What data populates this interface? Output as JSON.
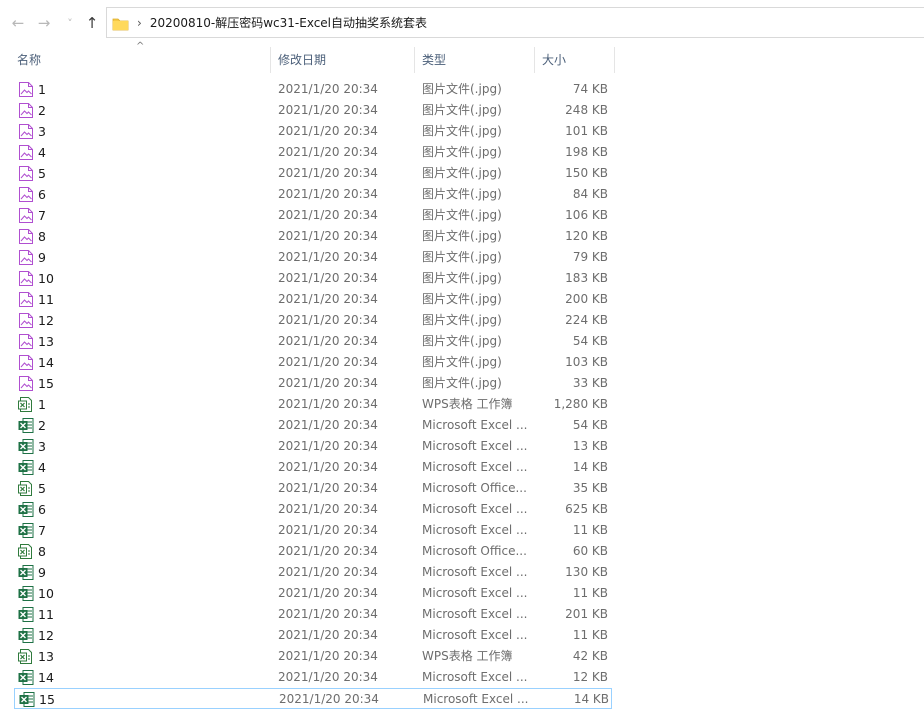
{
  "nav": {
    "back_glyph": "←",
    "forward_glyph": "→",
    "dropdown_glyph": "˅",
    "up_glyph": "↑",
    "separator": "›",
    "path": "20200810-解压密码wc31-Excel自动抽奖系统套表"
  },
  "sort_indicator": "^",
  "columns": {
    "name": "名称",
    "date": "修改日期",
    "type": "类型",
    "size": "大小"
  },
  "colors": {
    "image_icon": "#b04fd0",
    "excel_icon": "#1e7145",
    "wps_icon": "#2f7a3c",
    "header_text": "#4c607a",
    "selection_border": "#99d1ff"
  },
  "files": [
    {
      "name": "1",
      "date": "2021/1/20 20:34",
      "type": "图片文件(.jpg)",
      "size": "74 KB",
      "icon": "image-icon"
    },
    {
      "name": "2",
      "date": "2021/1/20 20:34",
      "type": "图片文件(.jpg)",
      "size": "248 KB",
      "icon": "image-icon"
    },
    {
      "name": "3",
      "date": "2021/1/20 20:34",
      "type": "图片文件(.jpg)",
      "size": "101 KB",
      "icon": "image-icon"
    },
    {
      "name": "4",
      "date": "2021/1/20 20:34",
      "type": "图片文件(.jpg)",
      "size": "198 KB",
      "icon": "image-icon"
    },
    {
      "name": "5",
      "date": "2021/1/20 20:34",
      "type": "图片文件(.jpg)",
      "size": "150 KB",
      "icon": "image-icon"
    },
    {
      "name": "6",
      "date": "2021/1/20 20:34",
      "type": "图片文件(.jpg)",
      "size": "84 KB",
      "icon": "image-icon"
    },
    {
      "name": "7",
      "date": "2021/1/20 20:34",
      "type": "图片文件(.jpg)",
      "size": "106 KB",
      "icon": "image-icon"
    },
    {
      "name": "8",
      "date": "2021/1/20 20:34",
      "type": "图片文件(.jpg)",
      "size": "120 KB",
      "icon": "image-icon"
    },
    {
      "name": "9",
      "date": "2021/1/20 20:34",
      "type": "图片文件(.jpg)",
      "size": "79 KB",
      "icon": "image-icon"
    },
    {
      "name": "10",
      "date": "2021/1/20 20:34",
      "type": "图片文件(.jpg)",
      "size": "183 KB",
      "icon": "image-icon"
    },
    {
      "name": "11",
      "date": "2021/1/20 20:34",
      "type": "图片文件(.jpg)",
      "size": "200 KB",
      "icon": "image-icon"
    },
    {
      "name": "12",
      "date": "2021/1/20 20:34",
      "type": "图片文件(.jpg)",
      "size": "224 KB",
      "icon": "image-icon"
    },
    {
      "name": "13",
      "date": "2021/1/20 20:34",
      "type": "图片文件(.jpg)",
      "size": "54 KB",
      "icon": "image-icon"
    },
    {
      "name": "14",
      "date": "2021/1/20 20:34",
      "type": "图片文件(.jpg)",
      "size": "103 KB",
      "icon": "image-icon"
    },
    {
      "name": "15",
      "date": "2021/1/20 20:34",
      "type": "图片文件(.jpg)",
      "size": "33 KB",
      "icon": "image-icon"
    },
    {
      "name": "1",
      "date": "2021/1/20 20:34",
      "type": "WPS表格 工作簿",
      "size": "1,280 KB",
      "icon": "wps-sheet-icon"
    },
    {
      "name": "2",
      "date": "2021/1/20 20:34",
      "type": "Microsoft Excel ...",
      "size": "54 KB",
      "icon": "excel-icon"
    },
    {
      "name": "3",
      "date": "2021/1/20 20:34",
      "type": "Microsoft Excel ...",
      "size": "13 KB",
      "icon": "excel-icon"
    },
    {
      "name": "4",
      "date": "2021/1/20 20:34",
      "type": "Microsoft Excel ...",
      "size": "14 KB",
      "icon": "excel-icon"
    },
    {
      "name": "5",
      "date": "2021/1/20 20:34",
      "type": "Microsoft Office...",
      "size": "35 KB",
      "icon": "wps-sheet-icon"
    },
    {
      "name": "6",
      "date": "2021/1/20 20:34",
      "type": "Microsoft Excel ...",
      "size": "625 KB",
      "icon": "excel-icon"
    },
    {
      "name": "7",
      "date": "2021/1/20 20:34",
      "type": "Microsoft Excel ...",
      "size": "11 KB",
      "icon": "excel-icon"
    },
    {
      "name": "8",
      "date": "2021/1/20 20:34",
      "type": "Microsoft Office...",
      "size": "60 KB",
      "icon": "wps-sheet-icon"
    },
    {
      "name": "9",
      "date": "2021/1/20 20:34",
      "type": "Microsoft Excel ...",
      "size": "130 KB",
      "icon": "excel-icon"
    },
    {
      "name": "10",
      "date": "2021/1/20 20:34",
      "type": "Microsoft Excel ...",
      "size": "11 KB",
      "icon": "excel-icon"
    },
    {
      "name": "11",
      "date": "2021/1/20 20:34",
      "type": "Microsoft Excel ...",
      "size": "201 KB",
      "icon": "excel-icon"
    },
    {
      "name": "12",
      "date": "2021/1/20 20:34",
      "type": "Microsoft Excel ...",
      "size": "11 KB",
      "icon": "excel-icon"
    },
    {
      "name": "13",
      "date": "2021/1/20 20:34",
      "type": "WPS表格 工作簿",
      "size": "42 KB",
      "icon": "wps-sheet-icon"
    },
    {
      "name": "14",
      "date": "2021/1/20 20:34",
      "type": "Microsoft Excel ...",
      "size": "12 KB",
      "icon": "excel-icon"
    },
    {
      "name": "15",
      "date": "2021/1/20 20:34",
      "type": "Microsoft Excel ...",
      "size": "14 KB",
      "icon": "excel-icon",
      "selected": true
    }
  ]
}
